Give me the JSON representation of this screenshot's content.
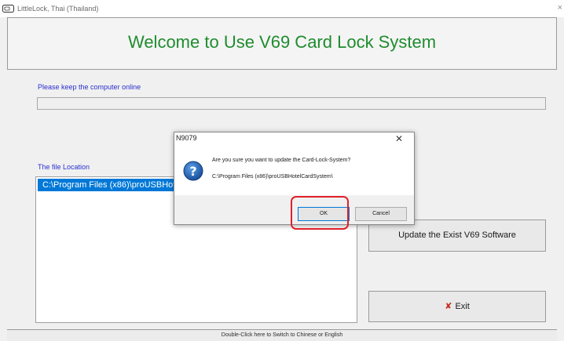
{
  "window": {
    "title": "LittleLock, Thai (Thailand)",
    "close_glyph": "×"
  },
  "banner": {
    "heading": "Welcome to Use V69 Card Lock System"
  },
  "online": {
    "label": "Please keep the computer online"
  },
  "file_location": {
    "label": "The file Location",
    "items": [
      "C:\\Program Files (x86)\\proUSBHotelCardSystem\\"
    ]
  },
  "buttons": {
    "update": "Update the Exist V69 Software",
    "exit": "Exit"
  },
  "statusbar": {
    "text": "Double-Click here to Switch to Chinese or English"
  },
  "dialog": {
    "title": "N9079",
    "close_glyph": "✕",
    "message": "Are you sure you want to update the Card-Lock-System?",
    "path": "C:\\Program Files (x86)\\proUSBHotelCardSystem\\",
    "ok": "OK",
    "cancel": "Cancel",
    "icon": "question-icon"
  },
  "colors": {
    "heading": "#1f8c2e",
    "label": "#2a2fd0",
    "selection": "#0078d7",
    "highlight": "#e0202a"
  }
}
